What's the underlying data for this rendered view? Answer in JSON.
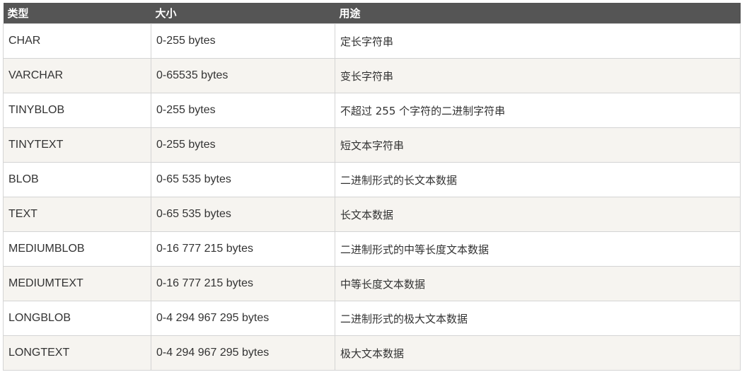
{
  "table": {
    "headers": [
      "类型",
      "大小",
      "用途"
    ],
    "rows": [
      {
        "type": "CHAR",
        "size": "0-255 bytes",
        "use": "定长字符串"
      },
      {
        "type": "VARCHAR",
        "size": "0-65535 bytes",
        "use": "变长字符串"
      },
      {
        "type": "TINYBLOB",
        "size": "0-255 bytes",
        "use": "不超过 255 个字符的二进制字符串"
      },
      {
        "type": "TINYTEXT",
        "size": "0-255 bytes",
        "use": "短文本字符串"
      },
      {
        "type": "BLOB",
        "size": "0-65 535 bytes",
        "use": "二进制形式的长文本数据"
      },
      {
        "type": "TEXT",
        "size": "0-65 535 bytes",
        "use": "长文本数据"
      },
      {
        "type": "MEDIUMBLOB",
        "size": "0-16 777 215 bytes",
        "use": "二进制形式的中等长度文本数据"
      },
      {
        "type": "MEDIUMTEXT",
        "size": "0-16 777 215 bytes",
        "use": "中等长度文本数据"
      },
      {
        "type": "LONGBLOB",
        "size": "0-4 294 967 295 bytes",
        "use": "二进制形式的极大文本数据"
      },
      {
        "type": "LONGTEXT",
        "size": "0-4 294 967 295 bytes",
        "use": "极大文本数据"
      }
    ]
  },
  "colors": {
    "header_bg": "#555555",
    "header_text": "#ffffff",
    "row_alt_bg": "#f6f4f0",
    "border": "#d4d4d4"
  }
}
